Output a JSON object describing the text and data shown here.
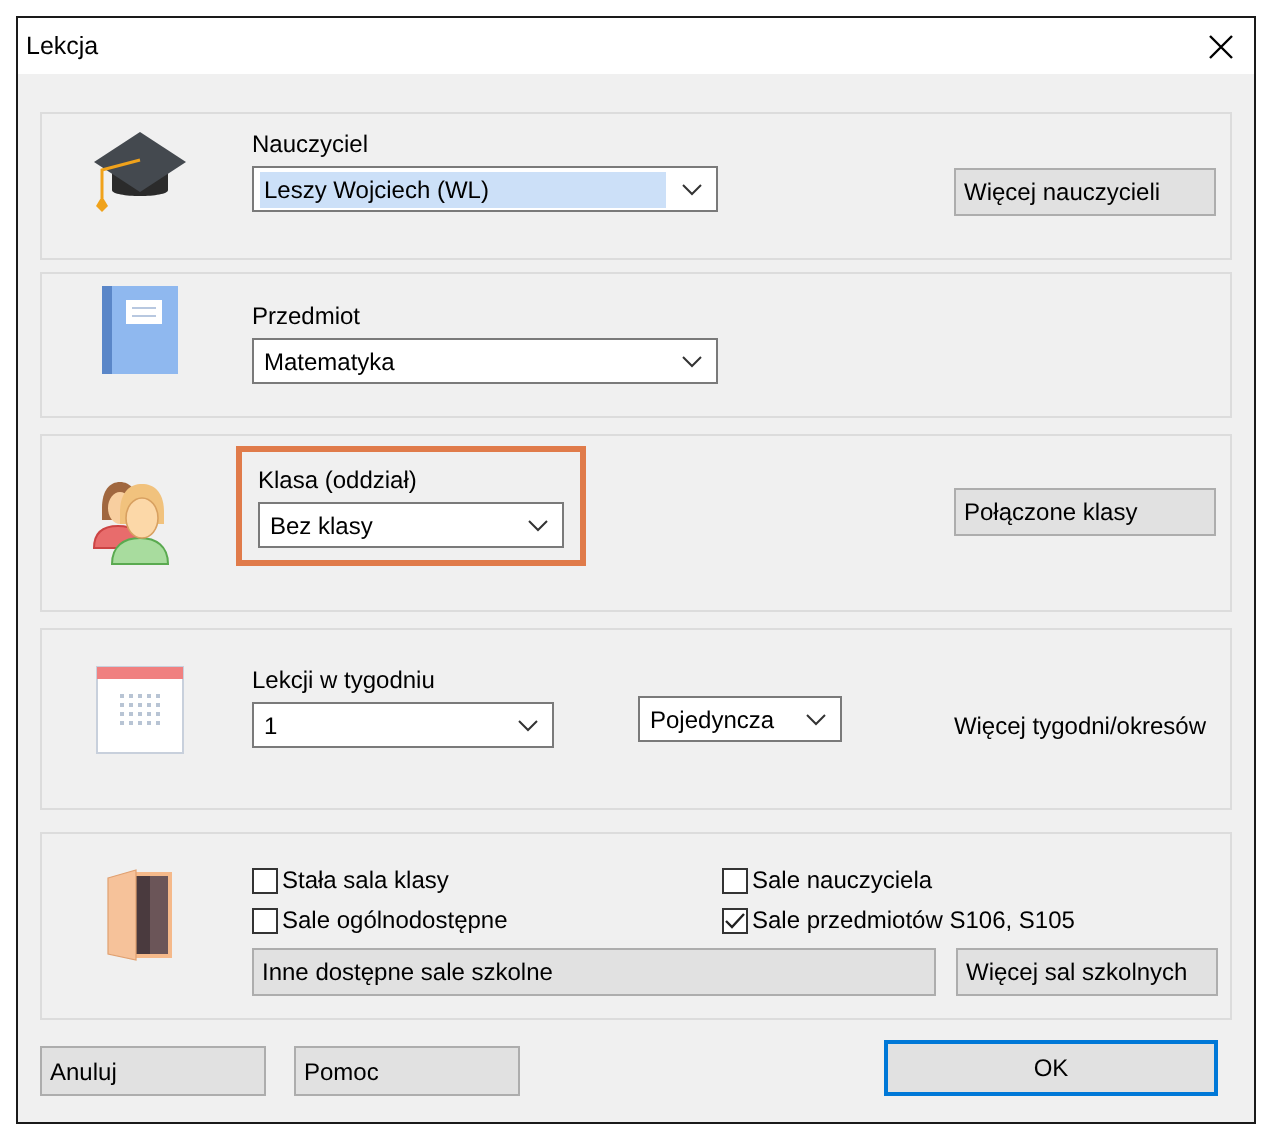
{
  "window": {
    "title": "Lekcja"
  },
  "teacher": {
    "label": "Nauczyciel",
    "value": "Leszy Wojciech (WL)",
    "text_selected": true,
    "button": "Więcej nauczycieli"
  },
  "subject": {
    "label": "Przedmiot",
    "value": "Matematyka"
  },
  "class": {
    "label": "Klasa (oddział)",
    "value": "Bez klasy",
    "highlighted": true,
    "button": "Połączone klasy"
  },
  "weekly": {
    "label": "Lekcji w tygodniu",
    "value": "1",
    "type_value": "Pojedyncza",
    "link": "Więcej tygodni/okresów"
  },
  "rooms": {
    "options": [
      {
        "label": "Stała sala klasy",
        "checked": false
      },
      {
        "label": "Sale ogólnodostępne",
        "checked": false
      },
      {
        "label": "Sale nauczyciela",
        "checked": false
      },
      {
        "label": "Sale przedmiotów S106, S105",
        "checked": true
      }
    ],
    "other_button": "Inne dostępne sale szkolne",
    "more_button": "Więcej sal szkolnych"
  },
  "buttons": [
    {
      "label": "Anuluj",
      "default": false
    },
    {
      "label": "Pomoc",
      "default": false
    },
    {
      "label": "OK",
      "default": true
    }
  ]
}
